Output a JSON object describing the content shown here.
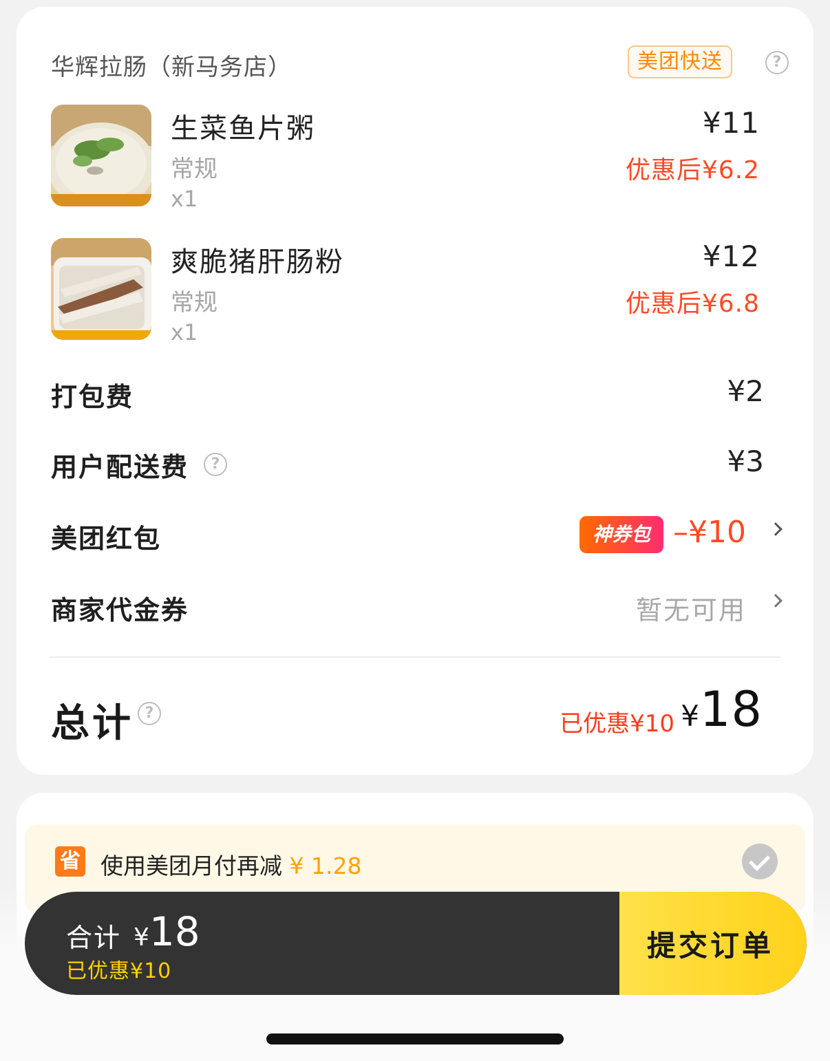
{
  "store": {
    "name": "华辉拉肠（新马务店）",
    "delivery_badge": "美团快送",
    "help": "?"
  },
  "items": [
    {
      "name": "生菜鱼片粥",
      "spec": "常规",
      "qty": "x1",
      "price": "¥11",
      "discount_price": "优惠后¥6.2",
      "image": "congee-photo"
    },
    {
      "name": "爽脆猪肝肠粉",
      "spec": "常规",
      "qty": "x1",
      "price": "¥12",
      "discount_price": "优惠后¥6.8",
      "image": "rice-roll-photo"
    }
  ],
  "fees": {
    "packing_label": "打包费",
    "packing_value": "¥2",
    "delivery_label": "用户配送费",
    "delivery_value": "¥3",
    "redpack_label": "美团红包",
    "redpack_badge": "神券包",
    "redpack_value": "–¥10",
    "merchant_label": "商家代金券",
    "merchant_value": "暂无可用"
  },
  "total": {
    "label": "总计",
    "saved": "已优惠¥10",
    "yen": "¥",
    "amount": "18"
  },
  "monthpay": {
    "icon": "省",
    "text": "使用美团月付再减",
    "amount": "¥ 1.28",
    "checked": true
  },
  "bottom_bar": {
    "total_label": "合计",
    "yen": "¥",
    "total_amount": "18",
    "saved": "已优惠¥10",
    "submit": "提交订单"
  },
  "colors": {
    "accent_red": "#ff4a25",
    "accent_orange": "#ff8a00",
    "submit_yellow": "#ffd21a",
    "bar_dark": "#333333"
  }
}
